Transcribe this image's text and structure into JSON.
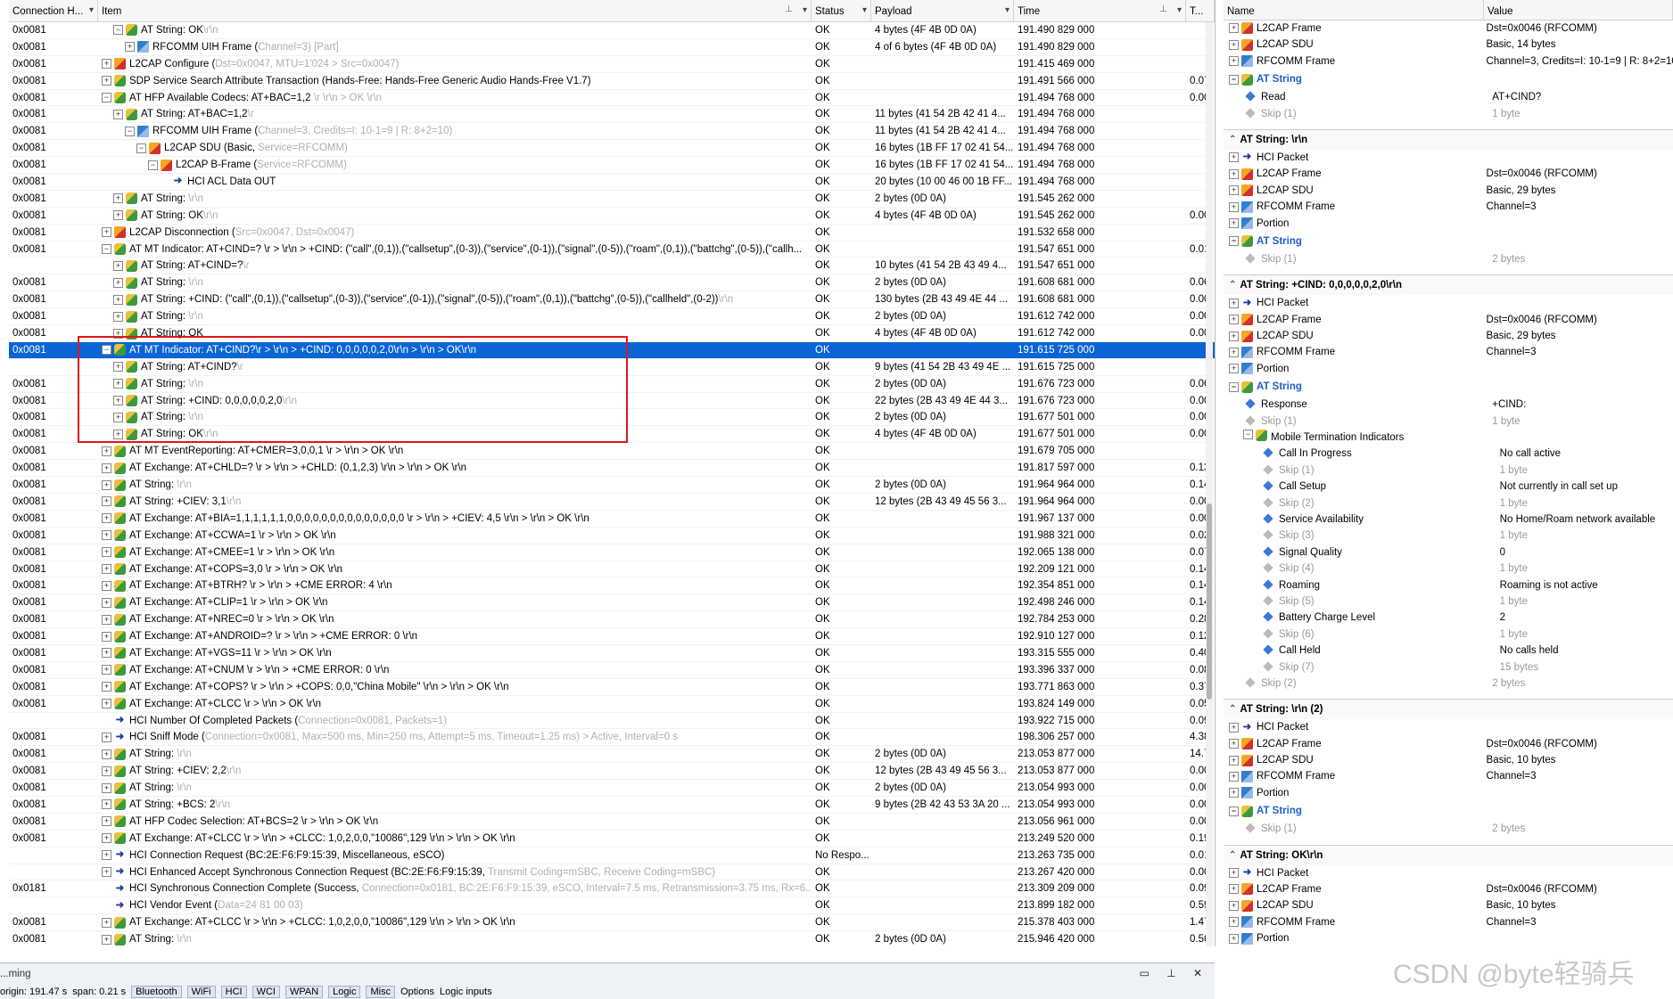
{
  "headers": [
    "Connection H...",
    "Item",
    "Status",
    "Payload",
    "Time",
    "T..."
  ],
  "rows": [
    {
      "c": "0x0081",
      "d": 1,
      "t": "-",
      "i": "at",
      "m": "AT String: OK",
      "g": "\\r\\n",
      "s": "OK",
      "p": "4 bytes (4F 4B 0D 0A)",
      "tm": "191.490 829 000",
      "td": ""
    },
    {
      "c": "0x0081",
      "d": 2,
      "t": "+",
      "i": "rf",
      "m": "RFCOMM UIH Frame (",
      "g": "Channel=3) [Part]",
      "s": "OK",
      "p": "4 of 6 bytes (4F 4B 0D 0A)",
      "tm": "191.490 829 000",
      "td": ""
    },
    {
      "c": "0x0081",
      "d": 0,
      "t": "+",
      "i": "l2",
      "m": "L2CAP Configure (",
      "g": "Dst=0x0047, MTU=1'024 > Src=0x0047)",
      "s": "OK",
      "p": "",
      "tm": "191.415 469 000",
      "td": ""
    },
    {
      "c": "0x0081",
      "d": 0,
      "t": "+",
      "i": "at",
      "m": "SDP Service Search Attribute Transaction (Hands-Free: Hands-Free Generic Audio Hands-Free V1.7)",
      "g": "",
      "s": "OK",
      "p": "",
      "tm": "191.491 566 000",
      "td": "0.07"
    },
    {
      "c": "0x0081",
      "d": 0,
      "t": "-",
      "i": "at",
      "m": "AT HFP Available Codecs: AT+BAC=1,2",
      "g": " \\r \\r\\n > OK \\r\\n",
      "s": "OK",
      "p": "",
      "tm": "191.494 768 000",
      "td": "0.00"
    },
    {
      "c": "0x0081",
      "d": 1,
      "t": "+",
      "i": "at",
      "m": "AT String: AT+BAC=1,2",
      "g": "\\r",
      "s": "OK",
      "p": "11 bytes (41 54 2B 42 41 4...",
      "tm": "191.494 768 000",
      "td": ""
    },
    {
      "c": "0x0081",
      "d": 2,
      "t": "-",
      "i": "rf",
      "m": "RFCOMM UIH Frame (",
      "g": "Channel=3, Credits=I: 10-1=9 | R: 8+2=10)",
      "s": "OK",
      "p": "11 bytes (41 54 2B 42 41 4...",
      "tm": "191.494 768 000",
      "td": ""
    },
    {
      "c": "0x0081",
      "d": 3,
      "t": "-",
      "i": "l2",
      "m": "L2CAP SDU (Basic, ",
      "g": "Service=RFCOMM)",
      "s": "OK",
      "p": "16 bytes (1B FF 17 02 41 54...",
      "tm": "191.494 768 000",
      "td": ""
    },
    {
      "c": "0x0081",
      "d": 4,
      "t": "-",
      "i": "l2",
      "m": "L2CAP B-Frame (",
      "g": "Service=RFCOMM)",
      "s": "OK",
      "p": "16 bytes (1B FF 17 02 41 54...",
      "tm": "191.494 768 000",
      "td": ""
    },
    {
      "c": "0x0081",
      "d": 5,
      "t": "",
      "i": "hci",
      "m": "HCI ACL Data OUT",
      "g": "",
      "s": "OK",
      "p": "20 bytes (10 00 46 00 1B FF...",
      "tm": "191.494 768 000",
      "td": ""
    },
    {
      "c": "0x0081",
      "d": 1,
      "t": "+",
      "i": "at",
      "m": "AT String: ",
      "g": "\\r\\n",
      "s": "OK",
      "p": "2 bytes (0D 0A)",
      "tm": "191.545 262 000",
      "td": ""
    },
    {
      "c": "0x0081",
      "d": 1,
      "t": "+",
      "i": "at",
      "m": "AT String: OK",
      "g": "\\r\\n",
      "s": "OK",
      "p": "4 bytes (4F 4B 0D 0A)",
      "tm": "191.545 262 000",
      "td": "0.00"
    },
    {
      "c": "0x0081",
      "d": 0,
      "t": "+",
      "i": "l2",
      "m": "L2CAP Disconnection (",
      "g": "Src=0x0047, Dst=0x0047)",
      "s": "OK",
      "p": "",
      "tm": "191.532 658 000",
      "td": ""
    },
    {
      "c": "0x0081",
      "d": 0,
      "t": "-",
      "i": "at",
      "m": "AT MT Indicator: AT+CIND=? \\r > \\r\\n > +CIND: (\"call\",(0,1)),(\"callsetup\",(0-3)),(\"service\",(0-1)),(\"signal\",(0-5)),(\"roam\",(0,1)),(\"battchg\",(0-5)),(\"callh...",
      "g": "",
      "s": "OK",
      "p": "",
      "tm": "191.547 651 000",
      "td": "0.01"
    },
    {
      "c": "",
      "d": 1,
      "t": "+",
      "i": "at",
      "m": "AT String: AT+CIND=?",
      "g": "\\r",
      "s": "OK",
      "p": "10 bytes (41 54 2B 43 49 4...",
      "tm": "191.547 651 000",
      "td": ""
    },
    {
      "c": "0x0081",
      "d": 1,
      "t": "+",
      "i": "at",
      "m": "AT String: ",
      "g": "\\r\\n",
      "s": "OK",
      "p": "2 bytes (0D 0A)",
      "tm": "191.608 681 000",
      "td": "0.06"
    },
    {
      "c": "0x0081",
      "d": 1,
      "t": "+",
      "i": "at",
      "m": "AT String: +CIND: (\"call\",(0,1)),(\"callsetup\",(0-3)),(\"service\",(0-1)),(\"signal\",(0-5)),(\"roam\",(0,1)),(\"battchg\",(0-5)),(\"callheld\",(0-2))",
      "g": "\\r\\n",
      "s": "OK",
      "p": "130 bytes (2B 43 49 4E 44 ...",
      "tm": "191.608 681 000",
      "td": "0.00"
    },
    {
      "c": "0x0081",
      "d": 1,
      "t": "+",
      "i": "at",
      "m": "AT String: ",
      "g": "\\r\\n",
      "s": "OK",
      "p": "2 bytes (0D 0A)",
      "tm": "191.612 742 000",
      "td": "0.00"
    },
    {
      "c": "0x0081",
      "d": 1,
      "t": "+",
      "i": "at",
      "m": "AT String: OK",
      "g": "",
      "s": "OK",
      "p": "4 bytes (4F 4B 0D 0A)",
      "tm": "191.612 742 000",
      "td": "0.00"
    },
    {
      "c": "0x0081",
      "d": 0,
      "t": "-",
      "i": "at",
      "m": "AT MT Indicator: AT+CIND?\\r > \\r\\n > +CIND: 0,0,0,0,0,2,0\\r\\n > \\r\\n > OK\\r\\n",
      "g": "",
      "s": "OK",
      "p": "",
      "tm": "191.615 725 000",
      "td": "",
      "sel": true
    },
    {
      "c": "",
      "d": 1,
      "t": "+",
      "i": "at",
      "m": "AT String: AT+CIND?",
      "g": "\\r",
      "s": "OK",
      "p": "9 bytes (41 54 2B 43 49 4E ...",
      "tm": "191.615 725 000",
      "td": ""
    },
    {
      "c": "0x0081",
      "d": 1,
      "t": "+",
      "i": "at",
      "m": "AT String: ",
      "g": "\\r\\n",
      "s": "OK",
      "p": "2 bytes (0D 0A)",
      "tm": "191.676 723 000",
      "td": "0.06"
    },
    {
      "c": "0x0081",
      "d": 1,
      "t": "+",
      "i": "at",
      "m": "AT String: +CIND: 0,0,0,0,0,2,0",
      "g": "\\r\\n",
      "s": "OK",
      "p": "22 bytes (2B 43 49 4E 44 3...",
      "tm": "191.676 723 000",
      "td": "0.00"
    },
    {
      "c": "0x0081",
      "d": 1,
      "t": "+",
      "i": "at",
      "m": "AT String: ",
      "g": "\\r\\n",
      "s": "OK",
      "p": "2 bytes (0D 0A)",
      "tm": "191.677 501 000",
      "td": "0.00"
    },
    {
      "c": "0x0081",
      "d": 1,
      "t": "+",
      "i": "at",
      "m": "AT String: OK",
      "g": "\\r\\n",
      "s": "OK",
      "p": "4 bytes (4F 4B 0D 0A)",
      "tm": "191.677 501 000",
      "td": "0.00"
    },
    {
      "c": "0x0081",
      "d": 0,
      "t": "+",
      "i": "at",
      "m": "AT MT EventReporting: AT+CMER=3,0,0,1 \\r > \\r\\n > OK \\r\\n",
      "g": "",
      "s": "OK",
      "p": "",
      "tm": "191.679 705 000",
      "td": ""
    },
    {
      "c": "0x0081",
      "d": 0,
      "t": "+",
      "i": "at",
      "m": "AT Exchange: AT+CHLD=? \\r > \\r\\n > +CHLD: (0,1,2,3) \\r\\n > \\r\\n > OK \\r\\n",
      "g": "",
      "s": "OK",
      "p": "",
      "tm": "191.817 597 000",
      "td": "0.13"
    },
    {
      "c": "0x0081",
      "d": 0,
      "t": "+",
      "i": "at",
      "m": "AT String: ",
      "g": "\\r\\n",
      "s": "OK",
      "p": "2 bytes (0D 0A)",
      "tm": "191.964 964 000",
      "td": "0.14"
    },
    {
      "c": "0x0081",
      "d": 0,
      "t": "+",
      "i": "at",
      "m": "AT String: +CIEV: 3,1",
      "g": "\\r\\n",
      "s": "OK",
      "p": "12 bytes (2B 43 49 45 56 3...",
      "tm": "191.964 964 000",
      "td": "0.00"
    },
    {
      "c": "0x0081",
      "d": 0,
      "t": "+",
      "i": "at",
      "m": "AT Exchange: AT+BIA=1,1,1,1,1,1,0,0,0,0,0,0,0,0,0,0,0,0,0,0 \\r > \\r\\n > +CIEV: 4,5 \\r\\n > \\r\\n > OK \\r\\n",
      "g": "",
      "s": "OK",
      "p": "",
      "tm": "191.967 137 000",
      "td": "0.00"
    },
    {
      "c": "0x0081",
      "d": 0,
      "t": "+",
      "i": "at",
      "m": "AT Exchange: AT+CCWA=1 \\r > \\r\\n > OK \\r\\n",
      "g": "",
      "s": "OK",
      "p": "",
      "tm": "191.988 321 000",
      "td": "0.02"
    },
    {
      "c": "0x0081",
      "d": 0,
      "t": "+",
      "i": "at",
      "m": "AT Exchange: AT+CMEE=1 \\r > \\r\\n > OK \\r\\n",
      "g": "",
      "s": "OK",
      "p": "",
      "tm": "192.065 138 000",
      "td": "0.07"
    },
    {
      "c": "0x0081",
      "d": 0,
      "t": "+",
      "i": "at",
      "m": "AT Exchange: AT+COPS=3,0 \\r > \\r\\n > OK \\r\\n",
      "g": "",
      "s": "OK",
      "p": "",
      "tm": "192.209 121 000",
      "td": "0.14"
    },
    {
      "c": "0x0081",
      "d": 0,
      "t": "+",
      "i": "at",
      "m": "AT Exchange: AT+BTRH? \\r > \\r\\n > +CME ERROR: 4 \\r\\n",
      "g": "",
      "s": "OK",
      "p": "",
      "tm": "192.354 851 000",
      "td": "0.14"
    },
    {
      "c": "0x0081",
      "d": 0,
      "t": "+",
      "i": "at",
      "m": "AT Exchange: AT+CLIP=1 \\r > \\r\\n > OK \\r\\n",
      "g": "",
      "s": "OK",
      "p": "",
      "tm": "192.498 246 000",
      "td": "0.14"
    },
    {
      "c": "0x0081",
      "d": 0,
      "t": "+",
      "i": "at",
      "m": "AT Exchange: AT+NREC=0 \\r > \\r\\n > OK \\r\\n",
      "g": "",
      "s": "OK",
      "p": "",
      "tm": "192.784 253 000",
      "td": "0.28"
    },
    {
      "c": "0x0081",
      "d": 0,
      "t": "+",
      "i": "at",
      "m": "AT Exchange: AT+ANDROID=? \\r > \\r\\n > +CME ERROR: 0 \\r\\n",
      "g": "",
      "s": "OK",
      "p": "",
      "tm": "192.910 127 000",
      "td": "0.12"
    },
    {
      "c": "0x0081",
      "d": 0,
      "t": "+",
      "i": "at",
      "m": "AT Exchange: AT+VGS=11 \\r > \\r\\n > OK \\r\\n",
      "g": "",
      "s": "OK",
      "p": "",
      "tm": "193.315 555 000",
      "td": "0.40"
    },
    {
      "c": "0x0081",
      "d": 0,
      "t": "+",
      "i": "at",
      "m": "AT Exchange: AT+CNUM \\r > \\r\\n > +CME ERROR: 0 \\r\\n",
      "g": "",
      "s": "OK",
      "p": "",
      "tm": "193.396 337 000",
      "td": "0.08"
    },
    {
      "c": "0x0081",
      "d": 0,
      "t": "+",
      "i": "at",
      "m": "AT Exchange: AT+COPS? \\r > \\r\\n > +COPS: 0,0,\"China Mobile\" \\r\\n > \\r\\n > OK \\r\\n",
      "g": "",
      "s": "OK",
      "p": "",
      "tm": "193.771 863 000",
      "td": "0.37"
    },
    {
      "c": "0x0081",
      "d": 0,
      "t": "+",
      "i": "at",
      "m": "AT Exchange: AT+CLCC \\r > \\r\\n > OK \\r\\n",
      "g": "",
      "s": "OK",
      "p": "",
      "tm": "193.824 149 000",
      "td": "0.05"
    },
    {
      "c": "",
      "d": 0,
      "t": "",
      "i": "hci",
      "m": "HCI Number Of Completed Packets (",
      "g": "Connection=0x0081, Packets=1)",
      "s": "OK",
      "p": "",
      "tm": "193.922 715 000",
      "td": "0.09"
    },
    {
      "c": "0x0081",
      "d": 0,
      "t": "+",
      "i": "hci",
      "m": "HCI Sniff Mode (",
      "g": "Connection=0x0081, Max=500 ms, Min=250 ms, Attempt=5 ms, Timeout=1.25 ms) > Active, Interval=0 s",
      "s": "OK",
      "p": "",
      "tm": "198.306 257 000",
      "td": "4.38"
    },
    {
      "c": "0x0081",
      "d": 0,
      "t": "+",
      "i": "at",
      "m": "AT String: ",
      "g": "\\r\\n",
      "s": "OK",
      "p": "2 bytes (0D 0A)",
      "tm": "213.053 877 000",
      "td": "14.7"
    },
    {
      "c": "0x0081",
      "d": 0,
      "t": "+",
      "i": "at",
      "m": "AT String: +CIEV: 2,2",
      "g": "\\r\\n",
      "s": "OK",
      "p": "12 bytes (2B 43 49 45 56 3...",
      "tm": "213.053 877 000",
      "td": "0.00"
    },
    {
      "c": "0x0081",
      "d": 0,
      "t": "+",
      "i": "at",
      "m": "AT String: ",
      "g": "\\r\\n",
      "s": "OK",
      "p": "2 bytes (0D 0A)",
      "tm": "213.054 993 000",
      "td": "0.00"
    },
    {
      "c": "0x0081",
      "d": 0,
      "t": "+",
      "i": "at",
      "m": "AT String: +BCS: 2",
      "g": "\\r\\n",
      "s": "OK",
      "p": "9 bytes (2B 42 43 53 3A 20 ...",
      "tm": "213.054 993 000",
      "td": "0.00"
    },
    {
      "c": "0x0081",
      "d": 0,
      "t": "+",
      "i": "at",
      "m": "AT HFP Codec Selection: AT+BCS=2 \\r > \\r\\n > OK \\r\\n",
      "g": "",
      "s": "OK",
      "p": "",
      "tm": "213.056 961 000",
      "td": "0.00"
    },
    {
      "c": "0x0081",
      "d": 0,
      "t": "+",
      "i": "at",
      "m": "AT Exchange: AT+CLCC \\r > \\r\\n > +CLCC: 1,0,2,0,0,\"10086\",129 \\r\\n > \\r\\n > OK \\r\\n",
      "g": "",
      "s": "OK",
      "p": "",
      "tm": "213.249 520 000",
      "td": "0.19"
    },
    {
      "c": "",
      "d": 0,
      "t": "+",
      "i": "hci",
      "m": "HCI Connection Request (BC:2E:F6:F9:15:39, Miscellaneous, eSCO)",
      "g": "",
      "s": "No Respo...",
      "p": "",
      "tm": "213.263 735 000",
      "td": "0.01"
    },
    {
      "c": "",
      "d": 0,
      "t": "+",
      "i": "hci",
      "m": "HCI Enhanced Accept Synchronous Connection Request (BC:2E:F6:F9:15:39, ",
      "g": "Transmit Coding=mSBC, Receive Coding=mSBC)",
      "s": "OK",
      "p": "",
      "tm": "213.267 420 000",
      "td": "0.00"
    },
    {
      "c": "0x0181",
      "d": 0,
      "t": "",
      "i": "hci",
      "m": "HCI Synchronous Connection Complete (Success, ",
      "g": "Connection=0x0181, BC:2E:F6:F9:15:39, eSCO, Interval=7.5 ms, Retransmission=3.75 ms, Rx=6...",
      "s": "OK",
      "p": "",
      "tm": "213.309 209 000",
      "td": "0.09"
    },
    {
      "c": "",
      "d": 0,
      "t": "",
      "i": "hci",
      "m": "HCI Vendor Event (",
      "g": "Data=24 81 00 03)",
      "s": "OK",
      "p": "",
      "tm": "213.899 182 000",
      "td": "0.59"
    },
    {
      "c": "0x0081",
      "d": 0,
      "t": "+",
      "i": "at",
      "m": "AT Exchange: AT+CLCC \\r > \\r\\n > +CLCC: 1,0,2,0,0,\"10086\",129 \\r\\n > \\r\\n > OK \\r\\n",
      "g": "",
      "s": "OK",
      "p": "",
      "tm": "215.378 403 000",
      "td": "1.47"
    },
    {
      "c": "0x0081",
      "d": 0,
      "t": "+",
      "i": "at",
      "m": "AT String: ",
      "g": "\\r\\n",
      "s": "OK",
      "p": "2 bytes (0D 0A)",
      "tm": "215.946 420 000",
      "td": "0.56"
    }
  ],
  "bottom": {
    "title": "...ming",
    "toolbar": [
      "origin: 191.47 s",
      "span: 0.21 s",
      "Bluetooth",
      "WiFi",
      "HCI",
      "WCI",
      "WPAN",
      "Logic",
      "Misc",
      "Options",
      "Logic inputs"
    ]
  },
  "right_headers": [
    "Name",
    "Value"
  ],
  "top_props": [
    {
      "n": "L2CAP Frame",
      "v": "Dst=0x0046 (RFCOMM)",
      "i": "l2"
    },
    {
      "n": "L2CAP SDU",
      "v": "Basic, 14 bytes",
      "i": "l2"
    },
    {
      "n": "RFCOMM Frame",
      "v": "Channel=3, Credits=I: 10-1=9 | R: 8+2=10",
      "i": "rf"
    }
  ],
  "top_at": {
    "title": "AT String",
    "rows": [
      {
        "n": "Read",
        "v": "AT+CIND?",
        "grey": false
      },
      {
        "n": "Skip (1)",
        "v": "1 byte",
        "grey": true
      }
    ]
  },
  "sections": [
    {
      "title": "AT String: \\r\\n",
      "props": [
        {
          "n": "HCI Packet",
          "v": "",
          "i": "hci"
        },
        {
          "n": "L2CAP Frame",
          "v": "Dst=0x0046 (RFCOMM)",
          "i": "l2"
        },
        {
          "n": "L2CAP SDU",
          "v": "Basic, 29 bytes",
          "i": "l2"
        },
        {
          "n": "RFCOMM Frame",
          "v": "Channel=3",
          "i": "rf"
        },
        {
          "n": "Portion",
          "v": "",
          "i": "rf"
        }
      ],
      "at_title": "AT String",
      "at_rows": [
        {
          "n": "Skip (1)",
          "v": "2 bytes",
          "grey": true
        }
      ]
    },
    {
      "title": "AT String: +CIND: 0,0,0,0,0,2,0\\r\\n",
      "props": [
        {
          "n": "HCI Packet",
          "v": "",
          "i": "hci"
        },
        {
          "n": "L2CAP Frame",
          "v": "Dst=0x0046 (RFCOMM)",
          "i": "l2"
        },
        {
          "n": "L2CAP SDU",
          "v": "Basic, 29 bytes",
          "i": "l2"
        },
        {
          "n": "RFCOMM Frame",
          "v": "Channel=3",
          "i": "rf"
        },
        {
          "n": "Portion",
          "v": "",
          "i": "rf"
        }
      ],
      "at_title": "AT String",
      "at_rows": [
        {
          "n": "Response",
          "v": "+CIND:",
          "grey": false
        },
        {
          "n": "Skip (1)",
          "v": "1 byte",
          "grey": true
        }
      ],
      "mti": {
        "title": "Mobile Termination Indicators",
        "rows": [
          {
            "n": "Call In Progress",
            "v": "No call active",
            "grey": false
          },
          {
            "n": "Skip (1)",
            "v": "1 byte",
            "grey": true
          },
          {
            "n": "Call Setup",
            "v": "Not currently in call set up",
            "grey": false
          },
          {
            "n": "Skip (2)",
            "v": "1 byte",
            "grey": true
          },
          {
            "n": "Service Availability",
            "v": "No Home/Roam network available",
            "grey": false
          },
          {
            "n": "Skip (3)",
            "v": "1 byte",
            "grey": true
          },
          {
            "n": "Signal Quality",
            "v": "0",
            "grey": false
          },
          {
            "n": "Skip (4)",
            "v": "1 byte",
            "grey": true
          },
          {
            "n": "Roaming",
            "v": "Roaming is not active",
            "grey": false
          },
          {
            "n": "Skip (5)",
            "v": "1 byte",
            "grey": true
          },
          {
            "n": "Battery Charge Level",
            "v": "2",
            "grey": false
          },
          {
            "n": "Skip (6)",
            "v": "1 byte",
            "grey": true
          },
          {
            "n": "Call Held",
            "v": "No calls held",
            "grey": false
          },
          {
            "n": "Skip (7)",
            "v": "15 bytes",
            "grey": true
          }
        ]
      },
      "after": [
        {
          "n": "Skip (2)",
          "v": "2 bytes",
          "grey": true
        }
      ]
    },
    {
      "title": "AT String: \\r\\n (2)",
      "props": [
        {
          "n": "HCI Packet",
          "v": "",
          "i": "hci"
        },
        {
          "n": "L2CAP Frame",
          "v": "Dst=0x0046 (RFCOMM)",
          "i": "l2"
        },
        {
          "n": "L2CAP SDU",
          "v": "Basic, 10 bytes",
          "i": "l2"
        },
        {
          "n": "RFCOMM Frame",
          "v": "Channel=3",
          "i": "rf"
        },
        {
          "n": "Portion",
          "v": "",
          "i": "rf"
        }
      ],
      "at_title": "AT String",
      "at_rows": [
        {
          "n": "Skip (1)",
          "v": "2 bytes",
          "grey": true
        }
      ]
    },
    {
      "title": "AT String: OK\\r\\n",
      "props": [
        {
          "n": "HCI Packet",
          "v": "",
          "i": "hci"
        },
        {
          "n": "L2CAP Frame",
          "v": "Dst=0x0046 (RFCOMM)",
          "i": "l2"
        },
        {
          "n": "L2CAP SDU",
          "v": "Basic, 10 bytes",
          "i": "l2"
        },
        {
          "n": "RFCOMM Frame",
          "v": "Channel=3",
          "i": "rf"
        },
        {
          "n": "Portion",
          "v": "",
          "i": "rf"
        }
      ]
    }
  ],
  "watermark": "CSDN @byte轻骑兵"
}
